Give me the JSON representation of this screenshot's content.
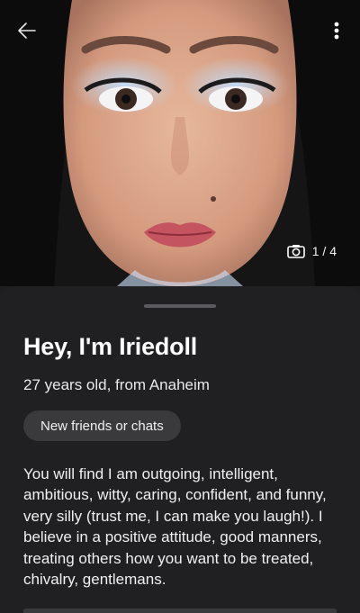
{
  "photo": {
    "counter": "1 / 4",
    "back_icon": "arrow-left-icon",
    "menu_icon": "more-vertical-icon",
    "camera_icon": "camera-icon"
  },
  "profile": {
    "title": "Hey, I'm Iriedoll",
    "subtitle": "27 years old, from Anaheim",
    "tag": "New friends or chats",
    "bio": "You will find I am outgoing, intelligent, ambitious, witty, caring, confident, and funny, very silly (trust me, I can make you laugh!). I believe in a positive attitude, good manners, treating others how you want to be treated, chivalry, gentlemans."
  },
  "colors": {
    "background": "#202022",
    "tag_background": "#3a3a3d",
    "text": "#ffffff"
  }
}
